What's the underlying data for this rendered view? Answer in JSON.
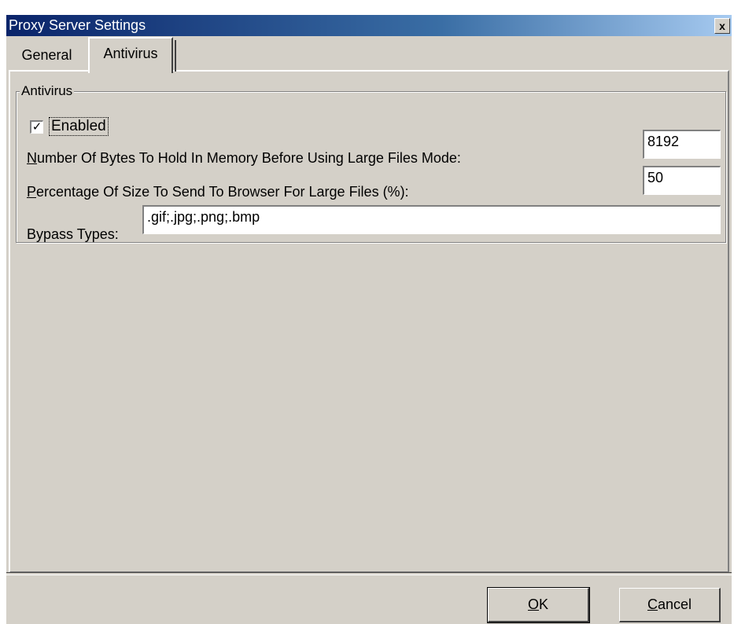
{
  "window": {
    "title": "Proxy Server Settings",
    "close_glyph": "x"
  },
  "tabs": [
    {
      "label": "General",
      "active": false
    },
    {
      "label": "Antivirus",
      "active": true
    }
  ],
  "antivirus_group": {
    "label": "Antivirus",
    "enabled": {
      "label": "Enabled",
      "checked": true,
      "check_glyph": "✓"
    },
    "bytes_field": {
      "label_mnemonic": "N",
      "label_rest": "umber Of Bytes To Hold In Memory Before Using Large Files Mode:",
      "value": "8192"
    },
    "percent_field": {
      "label_mnemonic": "P",
      "label_rest": "ercentage Of Size To Send To Browser For Large Files (%):",
      "value": "50"
    },
    "bypass_field": {
      "label": "Bypass Types:",
      "value": ".gif;.jpg;.png;.bmp"
    }
  },
  "buttons": {
    "ok": {
      "mnemonic": "O",
      "rest": "K"
    },
    "cancel": {
      "mnemonic": "C",
      "rest": "ancel"
    }
  },
  "colors": {
    "face": "#d4d0c8",
    "title_start": "#0a246a",
    "title_end": "#a6caf0"
  }
}
